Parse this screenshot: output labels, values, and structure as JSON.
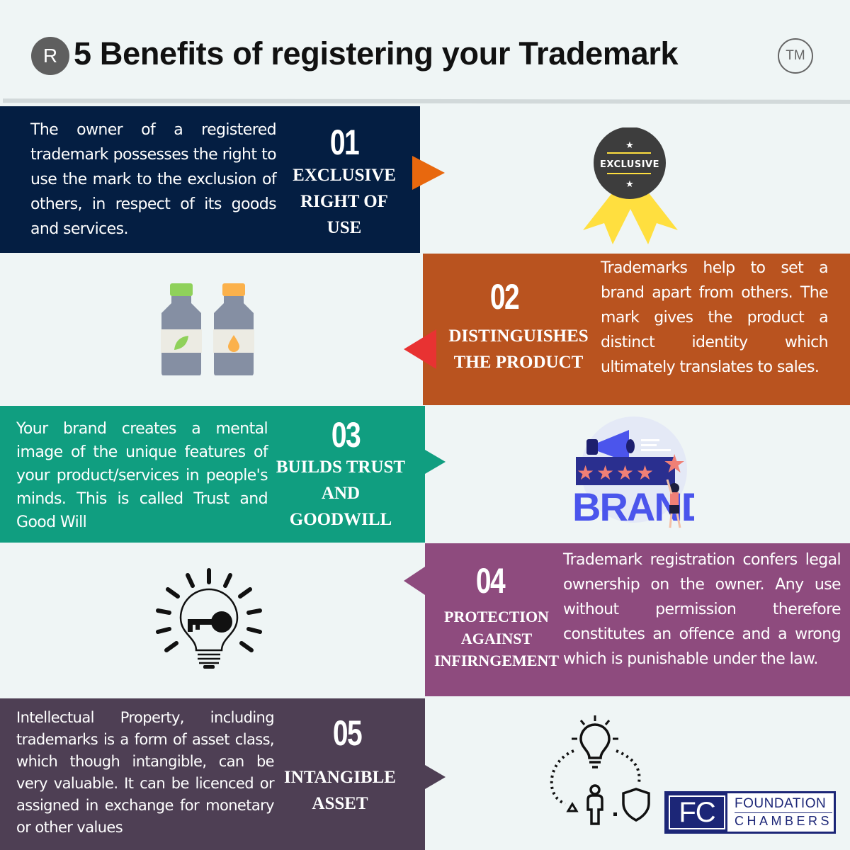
{
  "header": {
    "registered_symbol": "R",
    "title": "5 Benefits of registering your Trademark",
    "trademark_symbol": "TM"
  },
  "benefits": [
    {
      "number": "01",
      "heading": [
        "EXCLUSIVE",
        "RIGHT OF",
        "USE"
      ],
      "body": "The owner of a registered trademark  possesses the right to use the mark to the exclusion of others, in respect of its goods and services.",
      "color": "#041e42",
      "arrow_color": "#e8680e",
      "illustration": "exclusive-badge-icon",
      "badge_text": "EXCLUSIVE"
    },
    {
      "number": "02",
      "heading": [
        "DISTINGUISHES",
        "THE PRODUCT"
      ],
      "body": "Trademarks help to set a brand apart from others. The mark gives the product a distinct identity which ultimately translates to sales.",
      "color": "#b9531f",
      "arrow_color": "#e83232",
      "illustration": "product-bottles-icon"
    },
    {
      "number": "03",
      "heading": [
        "BUILDS TRUST",
        "AND",
        "GOODWILL"
      ],
      "body": "Your brand creates a mental image of the unique features of your product/services in people's minds. This is called Trust and Good Will",
      "color": "#109e80",
      "arrow_color": "#109e80",
      "illustration": "brand-rating-icon",
      "brand_text": "BRAND"
    },
    {
      "number": "04",
      "heading": [
        "PROTECTION",
        "AGAINST",
        "INFIRNGEMENT"
      ],
      "body": "Trademark registration confers legal ownership on the owner. Any use without permission therefore constitutes an offence and a wrong which is punishable under the law.",
      "color": "#8e4b7e",
      "arrow_color": "#8e4b7e",
      "illustration": "lightbulb-key-icon"
    },
    {
      "number": "05",
      "heading": [
        "INTANGIBLE",
        "ASSET"
      ],
      "body": "Intellectual Property, including trademarks  is a form of asset class, which though intangible, can be very valuable. It can be licenced or assigned in exchange for monetary or other values",
      "color": "#4e3f54",
      "arrow_color": "#4e3f54",
      "illustration": "idea-protection-icon"
    }
  ],
  "logo": {
    "initials": "FC",
    "line1": "FOUNDATION",
    "line2": "CHAMBERS"
  }
}
